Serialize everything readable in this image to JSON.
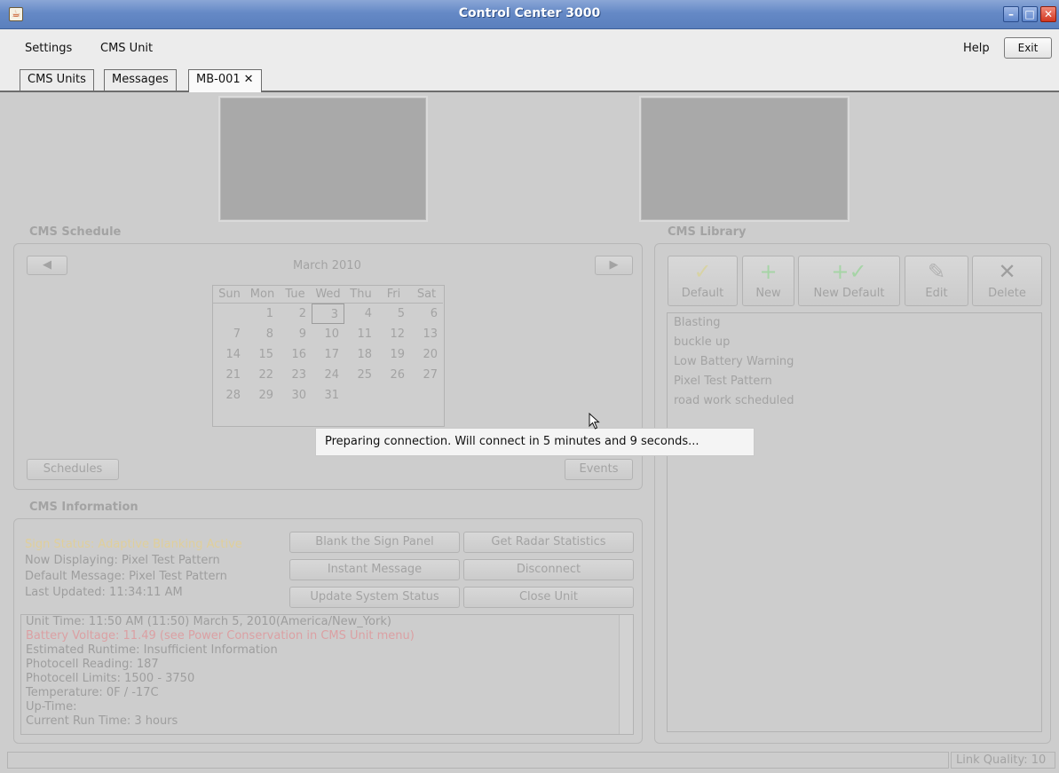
{
  "window": {
    "title": "Control Center 3000"
  },
  "menu": {
    "settings": "Settings",
    "cms_unit": "CMS Unit",
    "help": "Help",
    "exit": "Exit"
  },
  "tabs": [
    {
      "label": "CMS Units"
    },
    {
      "label": "Messages"
    },
    {
      "label": "MB-001",
      "close": "✕"
    }
  ],
  "schedule": {
    "title": "CMS Schedule",
    "month": "March 2010",
    "weekdays": [
      "Sun",
      "Mon",
      "Tue",
      "Wed",
      "Thu",
      "Fri",
      "Sat"
    ],
    "weeks": [
      [
        "",
        "1",
        "2",
        "3",
        "4",
        "5",
        "6"
      ],
      [
        "7",
        "8",
        "9",
        "10",
        "11",
        "12",
        "13"
      ],
      [
        "14",
        "15",
        "16",
        "17",
        "18",
        "19",
        "20"
      ],
      [
        "21",
        "22",
        "23",
        "24",
        "25",
        "26",
        "27"
      ],
      [
        "28",
        "29",
        "30",
        "31",
        "",
        "",
        ""
      ],
      [
        "",
        "",
        "",
        "",
        "",
        "",
        ""
      ]
    ],
    "selected_day": "3",
    "prev": "◀",
    "next": "▶",
    "schedules_btn": "Schedules",
    "events_btn": "Events"
  },
  "tooltip": "Preparing connection. Will connect in 5 minutes and 9 seconds...",
  "info": {
    "title": "CMS Information",
    "sign_status": "Sign Status: Adaptive Blanking Active",
    "now_displaying": "Now Displaying: Pixel Test Pattern",
    "default_message": "Default Message: Pixel Test Pattern",
    "last_updated": "Last Updated: 11:34:11 AM",
    "buttons": {
      "blank": "Blank the Sign Panel",
      "radar": "Get Radar Statistics",
      "instant": "Instant Message",
      "disconnect": "Disconnect",
      "update": "Update System Status",
      "close": "Close Unit"
    },
    "log": [
      "Unit Time: 11:50 AM (11:50) March 5, 2010(America/New_York)",
      "Battery Voltage: 11.49 (see Power Conservation in CMS Unit menu)",
      "Estimated Runtime: Insufficient Information",
      "Photocell Reading: 187",
      "Photocell Limits: 1500 - 3750",
      "Temperature: 0F / -17C",
      "Up-Time:",
      "Current Run Time: 3 hours"
    ]
  },
  "library": {
    "title": "CMS Library",
    "buttons": {
      "default": "Default",
      "new": "New",
      "new_default": "New Default",
      "edit": "Edit",
      "delete": "Delete"
    },
    "items": [
      "Blasting",
      "buckle up",
      "Low Battery Warning",
      "Pixel Test Pattern",
      "road work scheduled"
    ]
  },
  "status": {
    "link_quality": "Link Quality: 10"
  },
  "colors": {
    "status_warning": "#e0cf9a",
    "battery_warning": "#dba0a3",
    "title_bar": "#6589c6"
  }
}
